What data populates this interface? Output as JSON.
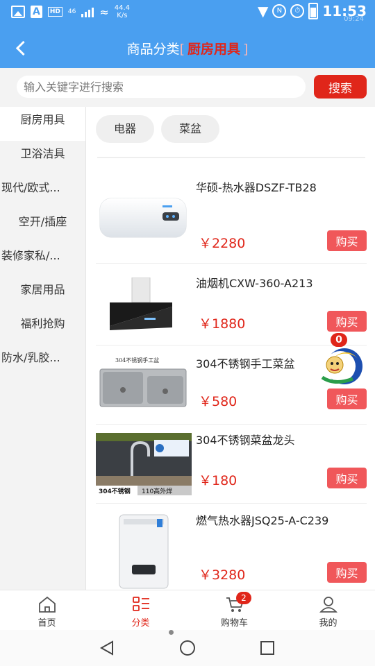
{
  "status_bar": {
    "a_label": "A",
    "hd_label": "HD",
    "signal_label": "46",
    "speed_value": "44.4",
    "speed_unit": "K/s",
    "time": "11:53",
    "ghost_time": "09:24"
  },
  "header": {
    "title": "商品分类",
    "bracket_open": "[",
    "category": "厨房用具",
    "bracket_close": "]"
  },
  "search": {
    "placeholder": "输入关键字进行搜索",
    "value": "",
    "button_label": "搜索"
  },
  "sidebar": {
    "items": [
      {
        "label": "厨房用具",
        "active": true
      },
      {
        "label": "卫浴洁具"
      },
      {
        "label": "现代/欧式..."
      },
      {
        "label": "空开/插座"
      },
      {
        "label": "装修家私/..."
      },
      {
        "label": "家居用品"
      },
      {
        "label": "福利抢购"
      },
      {
        "label": "防水/乳胶..."
      }
    ]
  },
  "subcategories": [
    "电器",
    "菜盆"
  ],
  "products": [
    {
      "name": "华硕-热水器DSZF-TB28",
      "price": "￥2280",
      "buy_label": "购买"
    },
    {
      "name": "油烟机CXW-360-A213",
      "price": "￥1880",
      "buy_label": "购买"
    },
    {
      "name": "304不锈钢手工菜盆",
      "price": "￥580",
      "buy_label": "购买",
      "image_text": "304不锈钢手工盆"
    },
    {
      "name": "304不锈钢菜盆龙头",
      "price": "￥180",
      "buy_label": "购买",
      "image_text_1": "304不锈钢",
      "image_text_2": "110高外焊"
    },
    {
      "name": "燃气热水器JSQ25-A-C239",
      "price": "￥3280",
      "buy_label": "购买"
    }
  ],
  "float_widget": {
    "count": "0"
  },
  "tabbar": {
    "tabs": [
      {
        "label": "首页"
      },
      {
        "label": "分类",
        "active": true
      },
      {
        "label": "购物车"
      },
      {
        "label": "我的"
      }
    ],
    "cart_count": "2"
  },
  "colors": {
    "primary_blue": "#4a9ff0",
    "accent_red": "#e0261a",
    "buy_button": "#f0575a"
  }
}
